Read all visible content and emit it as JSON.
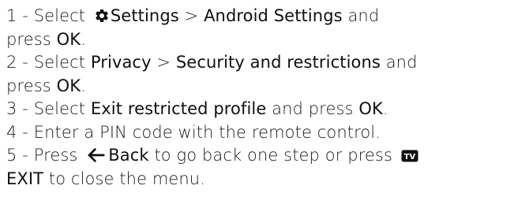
{
  "steps": [
    {
      "num": "1 -",
      "t1": "Select",
      "t2": "Settings",
      "t3": ">",
      "t4": "Android Settings",
      "t5": "and",
      "t6": "press",
      "t7": "OK",
      "t8": "."
    },
    {
      "num": "2 -",
      "t1": "Select",
      "t2": "Privacy",
      "t3": ">",
      "t4": "Security and restrictions",
      "t5": "and",
      "t6": "press",
      "t7": "OK",
      "t8": "."
    },
    {
      "num": "3 -",
      "t1": "Select",
      "t2": "Exit restricted profile",
      "t3": "and press",
      "t4": "OK",
      "t5": "."
    },
    {
      "num": "4 -",
      "t1": "Enter a PIN code with the remote control."
    },
    {
      "num": "5 -",
      "t1": "Press",
      "t2": "Back",
      "t3": "to go back one step or press",
      "t4": "EXIT",
      "t5": "to close the menu."
    }
  ],
  "icons": {
    "settings": "gear-icon",
    "back": "back-arrow-icon",
    "tv": "tv-icon"
  },
  "icon_text": {
    "tv": "TV"
  },
  "colors": {
    "text": "#1a1a1a",
    "icon": "#111111"
  }
}
